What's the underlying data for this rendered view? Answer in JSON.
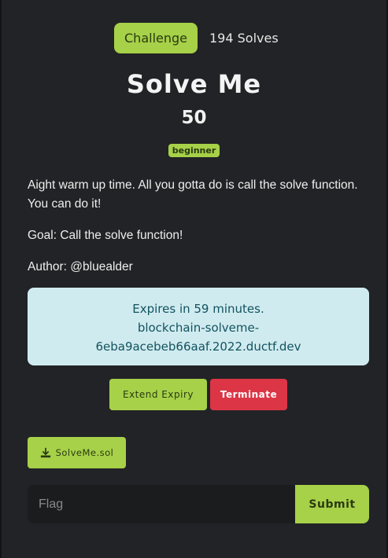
{
  "tabs": {
    "challenge_label": "Challenge",
    "solves_label": "194 Solves"
  },
  "challenge": {
    "name": "Solve Me",
    "points": "50",
    "tag": "beginner",
    "description": [
      "Aight warm up time. All you gotta do is call the solve function. You can do it!",
      "Goal: Call the solve function!",
      "Author: @bluealder"
    ]
  },
  "instance": {
    "expires": "Expires in 59 minutes.",
    "host_line1": "blockchain-solveme-",
    "host_line2": "6eba9acebeb66aaf.2022.ductf.dev"
  },
  "actions": {
    "extend_label": "Extend Expiry",
    "terminate_label": "Terminate"
  },
  "files": [
    {
      "name": "SolveMe.sol",
      "icon": "download-icon"
    }
  ],
  "flag_form": {
    "placeholder": "Flag",
    "value": "",
    "submit_label": "Submit"
  },
  "colors": {
    "accent": "#a6d148",
    "danger": "#dc3545",
    "info_bg": "#d0ebef",
    "info_text": "#125360",
    "modal_bg": "#222326"
  }
}
